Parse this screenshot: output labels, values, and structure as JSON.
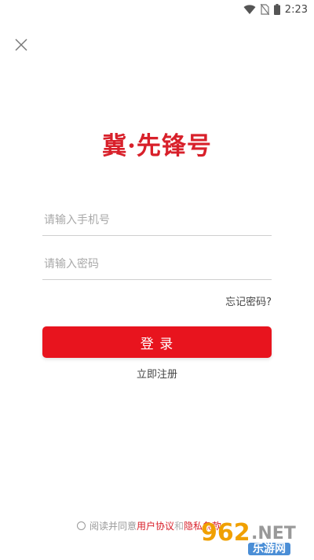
{
  "status_bar": {
    "time": "2:23",
    "icons": [
      "wifi-icon",
      "no-sim-icon",
      "battery-icon"
    ]
  },
  "header": {
    "close_icon": "close-icon"
  },
  "logo": {
    "text": "冀·先锋号",
    "color": "#d8202a"
  },
  "form": {
    "phone_placeholder": "请输入手机号",
    "phone_value": "",
    "password_placeholder": "请输入密码",
    "password_value": "",
    "forgot_label": "忘记密码?",
    "login_label": "登  录",
    "register_label": "立即注册"
  },
  "agreement": {
    "checked": false,
    "prefix": "阅读并同意",
    "user_agreement": "用户协议",
    "and": "和",
    "privacy_policy": "隐私条款"
  },
  "watermark": {
    "number": "962",
    "domain": ".NET",
    "subtitle": "乐游网"
  },
  "colors": {
    "primary": "#e8141e",
    "link": "#d8202a",
    "background": "#ffffff"
  }
}
